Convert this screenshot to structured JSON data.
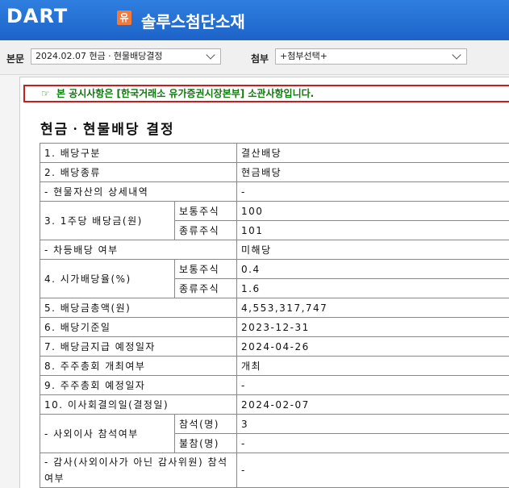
{
  "header": {
    "logo_text": "DART",
    "market_badge": "유",
    "company_name": "솔루스첨단소재"
  },
  "toolbar": {
    "body_label": "본문",
    "body_select_value": "2024.02.07  현금ㆍ현물배당결정",
    "attach_label": "첨부",
    "attach_select_value": "+첨부선택+"
  },
  "notice": {
    "icon": "☞",
    "text": "본 공시사항은 [한국거래소 유가증권시장본부] 소관사항입니다."
  },
  "document": {
    "title": "현금ㆍ현물배당 결정",
    "rows": [
      {
        "label": "1. 배당구분",
        "value": "결산배당"
      },
      {
        "label": "2. 배당종류",
        "value": "현금배당"
      },
      {
        "label": "- 현물자산의 상세내역",
        "value": "-"
      },
      {
        "label": "3. 1주당 배당금(원)",
        "sub1": "보통주식",
        "val1": "100",
        "sub2": "종류주식",
        "val2": "101"
      },
      {
        "label": "- 차등배당 여부",
        "value": "미해당"
      },
      {
        "label": "4. 시가배당율(%)",
        "sub1": "보통주식",
        "val1": "0.4",
        "sub2": "종류주식",
        "val2": "1.6"
      },
      {
        "label": "5. 배당금총액(원)",
        "value": "4,553,317,747"
      },
      {
        "label": "6. 배당기준일",
        "value": "2023-12-31"
      },
      {
        "label": "7. 배당금지급 예정일자",
        "value": "2024-04-26"
      },
      {
        "label": "8. 주주총회 개최여부",
        "value": "개최"
      },
      {
        "label": "9. 주주총회 예정일자",
        "value": "-"
      },
      {
        "label": "10. 이사회결의일(결정일)",
        "value": "2024-02-07"
      },
      {
        "label": "- 사외이사 참석여부",
        "sub1": "참석(명)",
        "val1": "3",
        "sub2": "불참(명)",
        "val2": "-"
      },
      {
        "label": "- 감사(사외이사가 아닌 감사위원) 참석여부",
        "value": "-"
      }
    ]
  }
}
